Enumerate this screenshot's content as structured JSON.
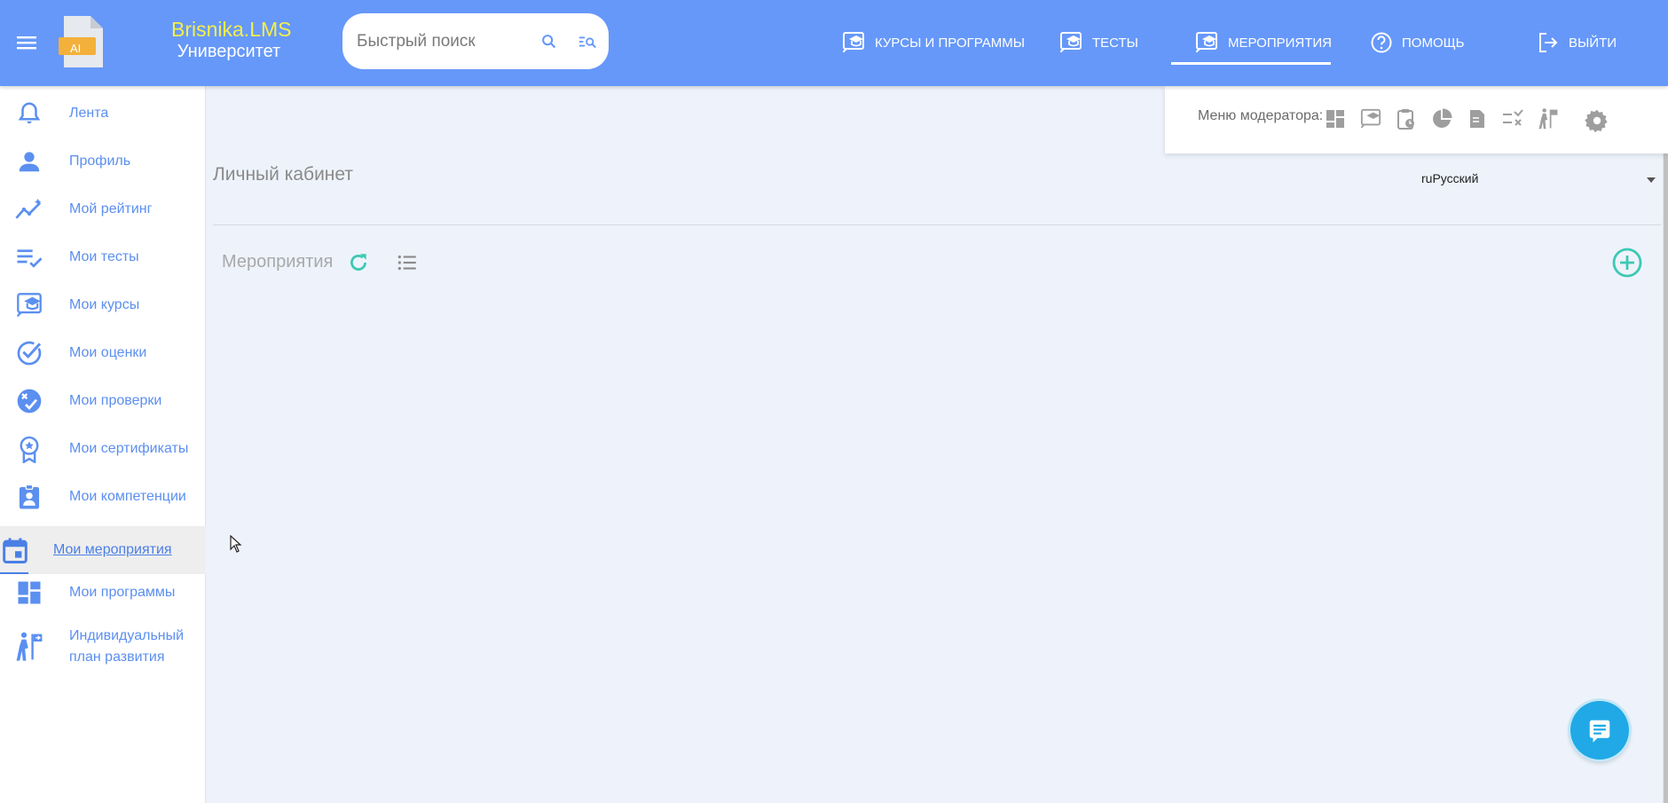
{
  "header": {
    "brand_line1": "Brisnika.LMS",
    "brand_line2": "Университет",
    "logo_badge": "AI",
    "search_placeholder": "Быстрый поиск",
    "nav": [
      {
        "label": "Курсы и программы",
        "icon": "cast-education-icon"
      },
      {
        "label": "Тесты",
        "icon": "cast-education-icon"
      },
      {
        "label": "Мероприятия",
        "icon": "cast-education-icon",
        "active": true
      },
      {
        "label": "Помощь",
        "icon": "help-circle-icon"
      },
      {
        "label": "Выйти",
        "icon": "logout-icon"
      }
    ]
  },
  "sidebar": {
    "items": [
      {
        "label": "Лента",
        "icon": "bell-icon"
      },
      {
        "label": "Профиль",
        "icon": "person-icon"
      },
      {
        "label": "Мой рейтинг",
        "icon": "rating-chart-icon"
      },
      {
        "label": "Мои тесты",
        "icon": "checklist-icon"
      },
      {
        "label": "Мои курсы",
        "icon": "cast-education-icon"
      },
      {
        "label": "Мои оценки",
        "icon": "check-circle-icon"
      },
      {
        "label": "Мои проверки",
        "icon": "review-icon"
      },
      {
        "label": "Мои сертификаты",
        "icon": "award-icon"
      },
      {
        "label": "Мои компетенции",
        "icon": "badge-person-icon"
      },
      {
        "label": "Мои мероприятия",
        "icon": "calendar-event-icon",
        "active": true
      },
      {
        "label": "Мои программы",
        "icon": "dashboard-icon"
      },
      {
        "label": "Индивидуальный",
        "label2": "план развития",
        "icon": "growth-path-icon"
      }
    ]
  },
  "moderator": {
    "label": "Меню модератора:",
    "icons": [
      "dashboard-icon",
      "cast-education-icon",
      "clipboard-clock-icon",
      "pie-chart-icon",
      "certificate-icon",
      "checklist-x-icon",
      "growth-path-icon",
      "gear-icon"
    ]
  },
  "main": {
    "page_title": "Личный кабинет",
    "language_value": "ruРусский",
    "section_title": "Мероприятия"
  },
  "colors": {
    "header_bg": "#6698f9",
    "brand_accent": "#f5ef4a",
    "sidebar_text": "#5b8ff0",
    "teal_action": "#3cc9b4",
    "chat_button": "#20a9e6"
  }
}
